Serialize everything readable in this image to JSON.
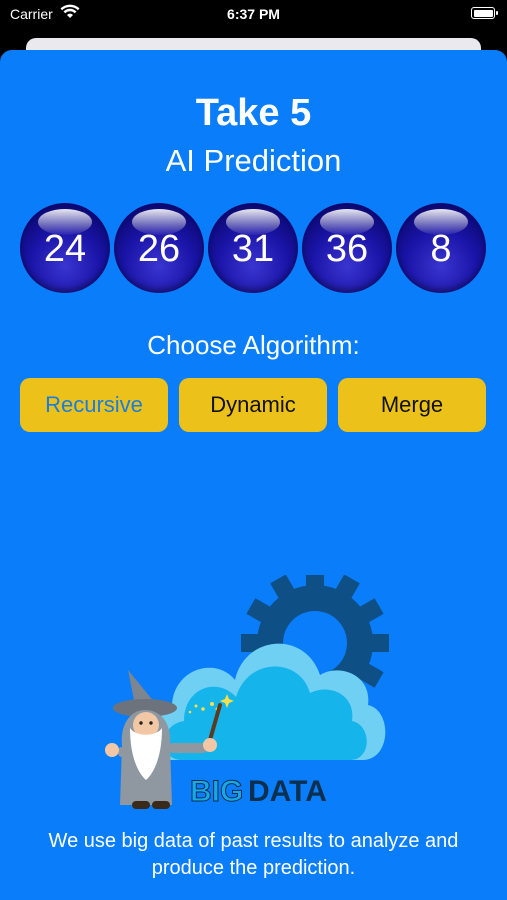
{
  "status_bar": {
    "carrier": "Carrier",
    "time": "6:37 PM"
  },
  "header": {
    "title": "Take 5",
    "subtitle": "AI Prediction"
  },
  "prediction": {
    "numbers": [
      "24",
      "26",
      "31",
      "36",
      "8"
    ]
  },
  "algorithm": {
    "prompt": "Choose Algorithm:",
    "options": [
      "Recursive",
      "Dynamic",
      "Merge"
    ],
    "selected": "Recursive"
  },
  "illustration": {
    "brand_text_1": "BIG",
    "brand_text_2": "DATA"
  },
  "caption": "We use big data of past results to analyze and produce the prediction.",
  "colors": {
    "background": "#0a7dfb",
    "button": "#ecc21a",
    "selected_text": "#1a7ee0",
    "ball": "#1a14a8"
  }
}
